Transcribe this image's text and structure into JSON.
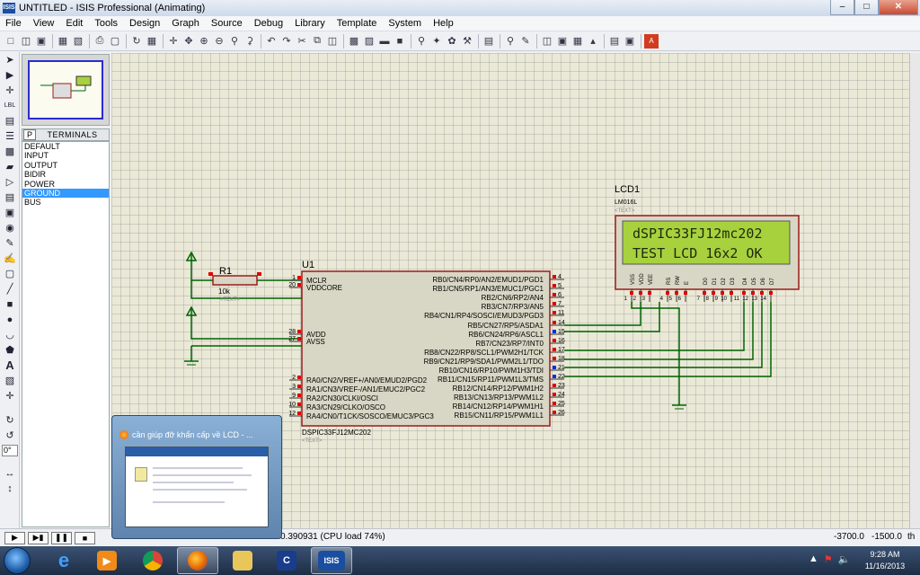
{
  "window": {
    "title": "UNTITLED - ISIS Professional (Animating)",
    "app_icon": "ISIS",
    "controls": {
      "minimize": "–",
      "maximize": "□",
      "close": "✕"
    }
  },
  "menu": [
    "File",
    "View",
    "Edit",
    "Tools",
    "Design",
    "Graph",
    "Source",
    "Debug",
    "Library",
    "Template",
    "System",
    "Help"
  ],
  "selector": {
    "p_button": "P",
    "title": "TERMINALS",
    "items": [
      "DEFAULT",
      "INPUT",
      "OUTPUT",
      "BIDIR",
      "POWER",
      "GROUND",
      "BUS"
    ],
    "selected": "GROUND"
  },
  "left_tools": {
    "angle": "0°"
  },
  "schematic": {
    "resistor": {
      "ref": "R1",
      "value": "10k",
      "text": "<TEXT>"
    },
    "mcu": {
      "ref": "U1",
      "part": "DSPIC33FJ12MC202",
      "text": "<TEXT>",
      "left_pins": [
        {
          "num": "1",
          "name": "MCLR"
        },
        {
          "num": "20",
          "name": "VDDCORE"
        },
        {
          "num": "28",
          "name": "AVDD"
        },
        {
          "num": "27",
          "name": "AVSS"
        },
        {
          "num": "2",
          "name": "RA0/CN2/VREF+/AN0/EMUD2/PGD2"
        },
        {
          "num": "3",
          "name": "RA1/CN3/VREF-/AN1/EMUC2/PGC2"
        },
        {
          "num": "9",
          "name": "RA2/CN30/CLKI/OSCI"
        },
        {
          "num": "10",
          "name": "RA3/CN29/CLKO/OSCO"
        },
        {
          "num": "12",
          "name": "RA4/CN0/T1CK/SOSCO/EMUC3/PGC3"
        }
      ],
      "right_pins": [
        {
          "num": "4",
          "name": "RB0/CN4/RP0/AN2/EMUD1/PGD1"
        },
        {
          "num": "5",
          "name": "RB1/CN5/RP1/AN3/EMUC1/PGC1"
        },
        {
          "num": "6",
          "name": "RB2/CN6/RP2/AN4"
        },
        {
          "num": "7",
          "name": "RB3/CN7/RP3/AN5"
        },
        {
          "num": "11",
          "name": "RB4/CN1/RP4/SOSCI/EMUD3/PGD3"
        },
        {
          "num": "14",
          "name": "RB5/CN27/RP5/ASDA1"
        },
        {
          "num": "15",
          "name": "RB6/CN24/RP6/ASCL1"
        },
        {
          "num": "16",
          "name": "RB7/CN23/RP7/INT0"
        },
        {
          "num": "17",
          "name": "RB8/CN22/RP8/SCL1/PWM2H1/TCK"
        },
        {
          "num": "18",
          "name": "RB9/CN21/RP9/SDA1/PWM2L1/TDO"
        },
        {
          "num": "21",
          "name": "RB10/CN16/RP10/PWM1H3/TDI"
        },
        {
          "num": "22",
          "name": "RB11/CN15/RP11/PWM1L3/TMS"
        },
        {
          "num": "23",
          "name": "RB12/CN14/RP12/PWM1H2"
        },
        {
          "num": "24",
          "name": "RB13/CN13/RP13/PWM1L2"
        },
        {
          "num": "25",
          "name": "RB14/CN12/RP14/PWM1H1"
        },
        {
          "num": "26",
          "name": "RB15/CN11/RP15/PWM1L1"
        }
      ]
    },
    "lcd": {
      "ref": "LCD1",
      "part": "LM016L",
      "text": "<TEXT>",
      "line1": "dSPIC33FJ12mc202",
      "line2": "TEST LCD 16x2 OK",
      "pins": [
        {
          "num": "1",
          "name": "VSS"
        },
        {
          "num": "2",
          "name": "VDD"
        },
        {
          "num": "3",
          "name": "VEE"
        },
        {
          "num": "4",
          "name": "RS"
        },
        {
          "num": "5",
          "name": "RW"
        },
        {
          "num": "6",
          "name": "E"
        },
        {
          "num": "7",
          "name": "D0"
        },
        {
          "num": "8",
          "name": "D1"
        },
        {
          "num": "9",
          "name": "D2"
        },
        {
          "num": "10",
          "name": "D3"
        },
        {
          "num": "11",
          "name": "D4"
        },
        {
          "num": "12",
          "name": "D5"
        },
        {
          "num": "13",
          "name": "D6"
        },
        {
          "num": "14",
          "name": "D7"
        }
      ]
    },
    "colors": {
      "wire": "#006400",
      "body": "#9b1c1c",
      "body_fill": "#d8d6c4",
      "lcd_screen": "#a8d13e",
      "pin_high": "#e00000",
      "pin_low": "#0030e0"
    }
  },
  "thumbnail": {
    "title": "cần giúp đỡ khẩn cấp về LCD - ..."
  },
  "status": {
    "sim": "0.390931 (CPU load 74%)",
    "x": "-3700.0",
    "y": "-1500.0",
    "units": "th"
  },
  "taskbar": {
    "time": "9:28 AM",
    "date": "11/16/2013"
  }
}
